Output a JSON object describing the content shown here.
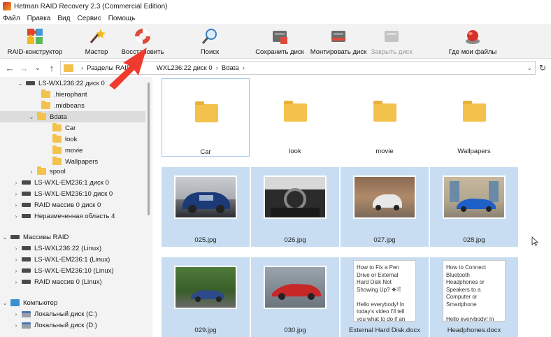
{
  "window": {
    "title": "Hetman RAID Recovery 2.3 (Commercial Edition)"
  },
  "menu": [
    "Файл",
    "Правка",
    "Вид",
    "Сервис",
    "Помощь"
  ],
  "toolbar": {
    "raid_builder": "RAID-конструктор",
    "wizard": "Мастер",
    "restore": "Восстановить",
    "search": "Поиск",
    "save_disk": "Сохранить диск",
    "mount_disk": "Монтировать диск",
    "close_disk": "Закрыть диск",
    "where_files": "Где мои файлы"
  },
  "address": {
    "crumbs": [
      "Разделы RAID",
      "WXL236:22 диск 0",
      "Bdata"
    ]
  },
  "tree": {
    "disk0": "LS-WXL236:22 диск 0",
    "hierophant": ".hierophant",
    "midbeans": ".midbeans",
    "bdata": "Bdata",
    "car": "Car",
    "look": "look",
    "movie": "movie",
    "wallpapers": "Wallpapers",
    "spool": "spool",
    "em1": "LS-WXL-EM236:1 диск 0",
    "em10": "LS-WXL-EM236:10 диск 0",
    "raid0": "RAID массив 0 диск 0",
    "unallocated": "Неразмеченная область 4",
    "raid_arrays": "Массивы RAID",
    "arr1": "LS-WXL236:22 (Linux)",
    "arr2": "LS-WXL-EM236:1 (Linux)",
    "arr3": "LS-WXL-EM236:10 (Linux)",
    "arr4": "RAID массив 0 (Linux)",
    "computer": "Компьютер",
    "local_c": "Локальный диск (C:)",
    "local_d": "Локальный диск (D:)"
  },
  "folders": [
    "Car",
    "look",
    "movie",
    "Wallpapers"
  ],
  "files": [
    {
      "name": "025.jpg"
    },
    {
      "name": "026.jpg"
    },
    {
      "name": "027.jpg"
    },
    {
      "name": "028.jpg"
    },
    {
      "name": "029.jpg"
    },
    {
      "name": "030.jpg"
    },
    {
      "name": "External Hard Disk.docx",
      "preview": "How to Fix a Pen\nDrive or External\nHard Disk Not\nShowing Up? ❖🖹\n\nHello everybody! In\ntoday's video I'll tell\nyou what to do if an"
    },
    {
      "name": "Headphones.docx",
      "preview": "How to Connect\nBluetooth\nHeadphones or\nSpeakers to a\nComputer or\nSmartphone\n\nHello everybodv! In"
    }
  ]
}
